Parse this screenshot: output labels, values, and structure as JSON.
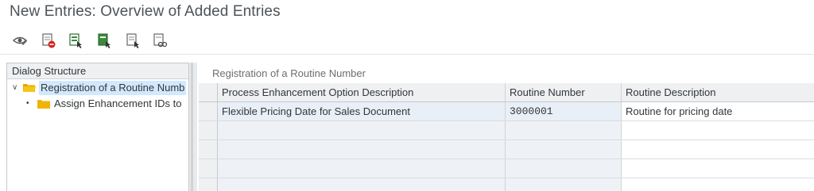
{
  "window": {
    "title": "New Entries: Overview of Added Entries"
  },
  "toolbar": {
    "buttons": [
      {
        "name": "display-change-icon"
      },
      {
        "name": "delete-icon"
      },
      {
        "name": "select-all-icon"
      },
      {
        "name": "select-block-icon"
      },
      {
        "name": "deselect-all-icon"
      },
      {
        "name": "where-used-icon"
      }
    ]
  },
  "dialog_structure": {
    "header": "Dialog Structure",
    "items": [
      {
        "label": "Registration of a Routine Numb",
        "expanded": true,
        "selected": true
      },
      {
        "label": "Assign Enhancement IDs to",
        "selected": false
      }
    ]
  },
  "main": {
    "section_title": "Registration of a Routine Number",
    "table": {
      "columns": [
        "Process Enhancement Option Description",
        "Routine Number",
        "Routine Description"
      ],
      "rows": [
        [
          "Flexible Pricing Date for Sales Document",
          "3000001",
          "Routine for pricing date"
        ]
      ]
    }
  },
  "colors": {
    "selection": "#d1e8ff",
    "folder": "#f0b400",
    "header_bg": "#eef0f2"
  }
}
